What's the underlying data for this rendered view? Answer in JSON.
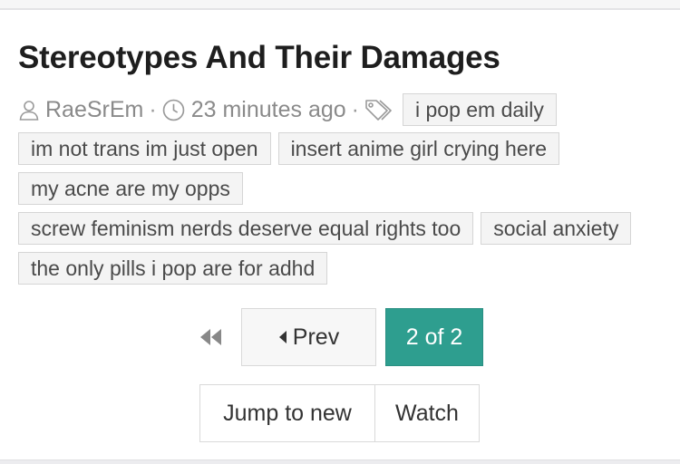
{
  "thread": {
    "title": "Stereotypes And Their Damages",
    "author": "RaeSrEm",
    "time": "23 minutes ago",
    "separator": "·",
    "tags": [
      "i pop em daily",
      "im not trans im just open",
      "insert anime girl crying here",
      "my acne are my opps",
      "screw feminism nerds deserve equal rights too",
      "social anxiety",
      "the only pills i pop are for adhd"
    ]
  },
  "pagination": {
    "first_icon": "double-chevron-left-icon",
    "prev_label": "Prev",
    "page_indicator": "2 of 2",
    "accent_color": "#2e9e8f"
  },
  "actions": {
    "jump_label": "Jump to new",
    "watch_label": "Watch"
  },
  "icons": {
    "author": "user-icon",
    "time": "clock-icon",
    "tags": "tags-icon"
  }
}
